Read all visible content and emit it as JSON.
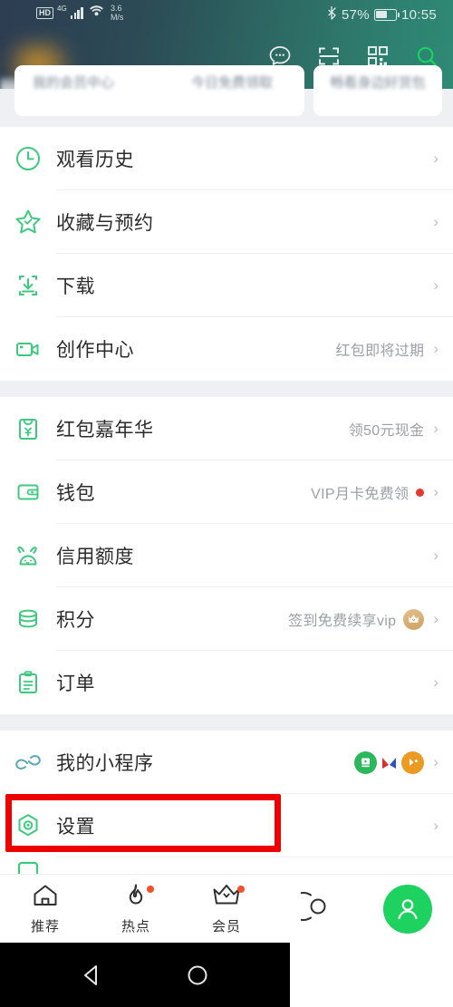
{
  "statusbar": {
    "hd": "HD",
    "network": "4G",
    "speed_value": "3.6",
    "speed_unit": "M/s",
    "bluetooth_icon": "bluetooth-icon",
    "battery_percent": "57%",
    "time": "10:55"
  },
  "header": {
    "icons": [
      {
        "name": "message-icon",
        "label": "消息"
      },
      {
        "name": "scan-icon",
        "label": "扫一扫"
      },
      {
        "name": "qrcode-icon",
        "label": "二维码"
      },
      {
        "name": "search-icon",
        "label": "搜索"
      }
    ],
    "accent_green": "#17d45f"
  },
  "cards": {
    "card_a_left": "我的会员中心",
    "card_a_right": "今日免费领取",
    "card_b": "畅看身边好货包"
  },
  "groups": [
    {
      "items": [
        {
          "icon": "clock-icon",
          "label": "观看历史",
          "note": "",
          "badge": ""
        },
        {
          "icon": "star-icon",
          "label": "收藏与预约",
          "note": "",
          "badge": ""
        },
        {
          "icon": "download-icon",
          "label": "下载",
          "note": "",
          "badge": ""
        },
        {
          "icon": "video-camera-icon",
          "label": "创作中心",
          "note": "红包即将过期",
          "badge": ""
        }
      ]
    },
    {
      "items": [
        {
          "icon": "red-envelope-icon",
          "label": "红包嘉年华",
          "note": "领50元现金",
          "badge": ""
        },
        {
          "icon": "wallet-icon",
          "label": "钱包",
          "note": "VIP月卡免费领",
          "badge": "red-dot"
        },
        {
          "icon": "rabbit-icon",
          "label": "信用额度",
          "note": "",
          "badge": ""
        },
        {
          "icon": "coins-icon",
          "label": "积分",
          "note": "签到免费续享vip",
          "badge": "vip-crown"
        },
        {
          "icon": "clipboard-icon",
          "label": "订单",
          "note": "",
          "badge": ""
        }
      ]
    },
    {
      "items": [
        {
          "icon": "link-icon",
          "label": "我的小程序",
          "note": "",
          "badge": "mini-programs"
        },
        {
          "icon": "settings-gear-icon",
          "label": "设置",
          "note": "",
          "badge": ""
        }
      ]
    }
  ],
  "annotation": {
    "target": "设置",
    "color": "#ef0000"
  },
  "bottom_nav": {
    "items": [
      {
        "icon": "home-icon",
        "label": "推荐",
        "dot": false
      },
      {
        "icon": "fire-icon",
        "label": "热点",
        "dot": true
      },
      {
        "icon": "crown-icon",
        "label": "会员",
        "dot": true
      },
      {
        "icon": "circle-record-icon",
        "label": "",
        "dot": false
      }
    ],
    "profile_button": {
      "icon": "person-avatar-icon",
      "label": "我的"
    }
  },
  "android_nav": {
    "back": "back-triangle-icon",
    "home": "home-circle-icon"
  }
}
